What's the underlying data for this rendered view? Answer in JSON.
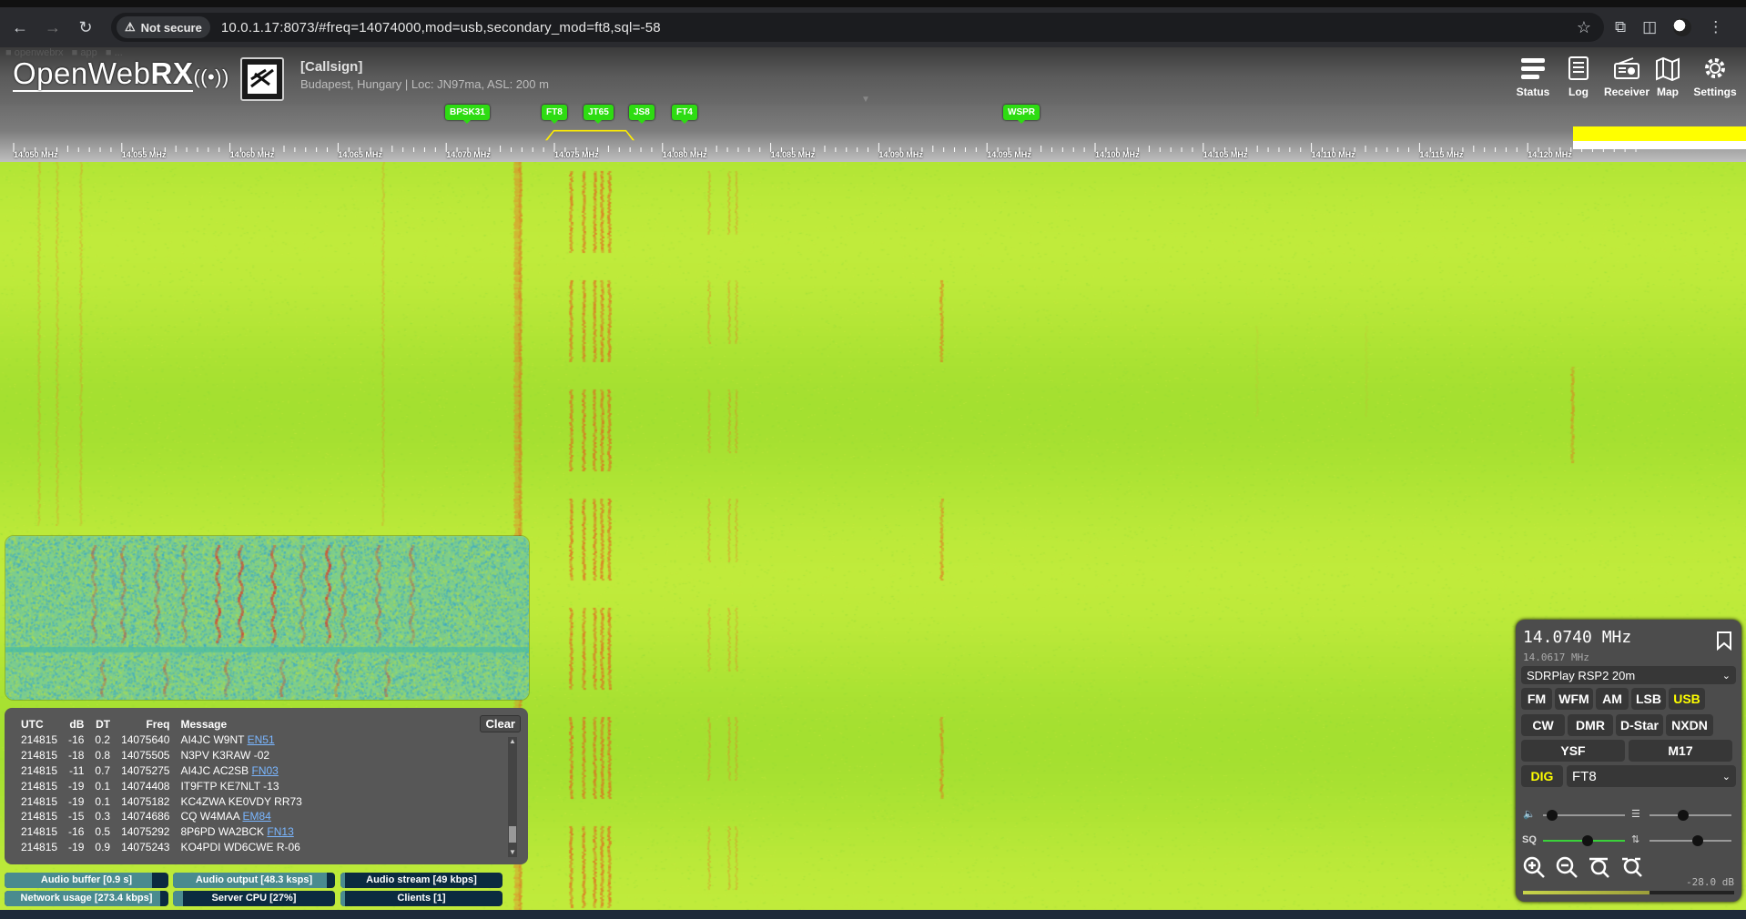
{
  "browser": {
    "security_label": "Not secure",
    "url": "10.0.1.17:8073/#freq=14074000,mod=usb,secondary_mod=ft8,sql=-58"
  },
  "header": {
    "logo_text_light": "OpenWeb",
    "logo_text_bold": "RX",
    "callsign": "[Callsign]",
    "location": "Budapest, Hungary | Loc: JN97ma, ASL: 200 m",
    "tools": [
      {
        "label": "Status",
        "icon": "status-icon"
      },
      {
        "label": "Log",
        "icon": "log-icon"
      },
      {
        "label": "Receiver",
        "icon": "receiver-icon"
      },
      {
        "label": "Map",
        "icon": "map-icon"
      },
      {
        "label": "Settings",
        "icon": "settings-icon"
      }
    ]
  },
  "bookmarks": [
    "BPSK31",
    "FT8",
    "JT65",
    "JS8",
    "FT4",
    "WSPR"
  ],
  "scale_labels": [
    "14.050 MHz",
    "14.055 MHz",
    "14.060 MHz",
    "14.065 MHz",
    "14.070 MHz",
    "14.075 MHz",
    "14.080 MHz",
    "14.085 MHz",
    "14.090 MHz",
    "14.095 MHz",
    "14.100 MHz",
    "14.105 MHz",
    "14.110 MHz",
    "14.115 MHz",
    "14.120 MHz"
  ],
  "decodes": {
    "columns": [
      "UTC",
      "dB",
      "DT",
      "Freq",
      "Message"
    ],
    "clear_label": "Clear",
    "rows": [
      {
        "utc": "214815",
        "db": "-16",
        "dt": "0.2",
        "freq": "14075640",
        "msg": "AI4JC W9NT",
        "loc": "EN51"
      },
      {
        "utc": "214815",
        "db": "-18",
        "dt": "0.8",
        "freq": "14075505",
        "msg": "N3PV K3RAW -02",
        "loc": ""
      },
      {
        "utc": "214815",
        "db": "-11",
        "dt": "0.7",
        "freq": "14075275",
        "msg": "AI4JC AC2SB",
        "loc": "FN03"
      },
      {
        "utc": "214815",
        "db": "-19",
        "dt": "0.1",
        "freq": "14074408",
        "msg": "IT9FTP KE7NLT -13",
        "loc": ""
      },
      {
        "utc": "214815",
        "db": "-19",
        "dt": "0.1",
        "freq": "14075182",
        "msg": "KC4ZWA KE0VDY RR73",
        "loc": ""
      },
      {
        "utc": "214815",
        "db": "-15",
        "dt": "0.3",
        "freq": "14074686",
        "msg": "CQ W4MAA",
        "loc": "EM84"
      },
      {
        "utc": "214815",
        "db": "-16",
        "dt": "0.5",
        "freq": "14075292",
        "msg": "8P6PD WA2BCK",
        "loc": "FN13"
      },
      {
        "utc": "214815",
        "db": "-19",
        "dt": "0.9",
        "freq": "14075243",
        "msg": "KO4PDI WD6CWE R-06",
        "loc": ""
      }
    ]
  },
  "status": {
    "audio_buffer": "Audio buffer [0.9 s]",
    "audio_output": "Audio output [48.3 ksps]",
    "audio_stream": "Audio stream [49 kbps]",
    "network_usage": "Network usage [273.4 kbps]",
    "server_cpu": "Server CPU [27%]",
    "clients": "Clients [1]",
    "levels": {
      "audio_buffer": 0.9,
      "audio_output": 0.95,
      "audio_stream": 0.03,
      "network_usage": 0.95,
      "server_cpu": 0.06,
      "clients": 0.03
    }
  },
  "receiver": {
    "frequency": "14.0740 MHz",
    "offset_frequency": "14.0617 MHz",
    "profile": "SDRPlay RSP2 20m",
    "modes_row1": [
      "FM",
      "WFM",
      "AM",
      "LSB",
      "USB"
    ],
    "modes_row2": [
      "CW",
      "DMR",
      "D-Star",
      "NXDN"
    ],
    "modes_row3": [
      "YSF",
      "M17"
    ],
    "active_mode": "USB",
    "dig_label": "DIG",
    "digital_mode": "FT8",
    "squelch_label": "SQ",
    "db_reading": "-28.0 dB",
    "volume": 0.05,
    "squelch": 0.55,
    "nr": 0.4,
    "agc": 0.6,
    "smeter": 0.6
  }
}
